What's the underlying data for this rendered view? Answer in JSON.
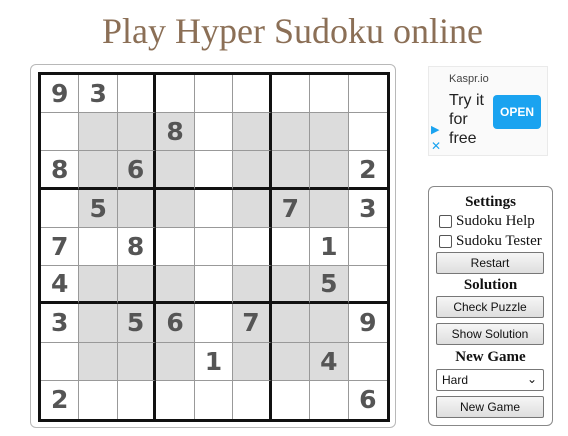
{
  "page": {
    "title": "Play Hyper Sudoku online"
  },
  "board": {
    "rows": [
      [
        "9",
        "3",
        "",
        "",
        "",
        "",
        "",
        "",
        ""
      ],
      [
        "",
        "",
        "",
        "8",
        "",
        "",
        "",
        "",
        ""
      ],
      [
        "8",
        "",
        "6",
        "",
        "",
        "",
        "",
        "",
        "2"
      ],
      [
        "",
        "5",
        "",
        "",
        "",
        "",
        "7",
        "",
        "3"
      ],
      [
        "7",
        "",
        "8",
        "",
        "",
        "",
        "",
        "1",
        ""
      ],
      [
        "4",
        "",
        "",
        "",
        "",
        "",
        "",
        "5",
        ""
      ],
      [
        "3",
        "",
        "5",
        "6",
        "",
        "7",
        "",
        "",
        "9"
      ],
      [
        "",
        "",
        "",
        "",
        "1",
        "",
        "",
        "4",
        ""
      ],
      [
        "2",
        "",
        "",
        "",
        "",
        "",
        "",
        "",
        "6"
      ]
    ],
    "hyper_color": "#dcdcdc"
  },
  "ad": {
    "brand": "Kaspr.io",
    "text": "Try it\nfor\nfree",
    "button": "OPEN",
    "play_icon": "play-triangle-icon",
    "close_icon": "close-x-icon"
  },
  "settings": {
    "heading": "Settings",
    "help_label": "Sudoku Help",
    "tester_label": "Sudoku Tester",
    "restart_label": "Restart",
    "solution_heading": "Solution",
    "check_label": "Check Puzzle",
    "show_solution_label": "Show Solution",
    "new_game_heading": "New Game",
    "difficulty": "Hard",
    "new_game_label": "New Game"
  }
}
